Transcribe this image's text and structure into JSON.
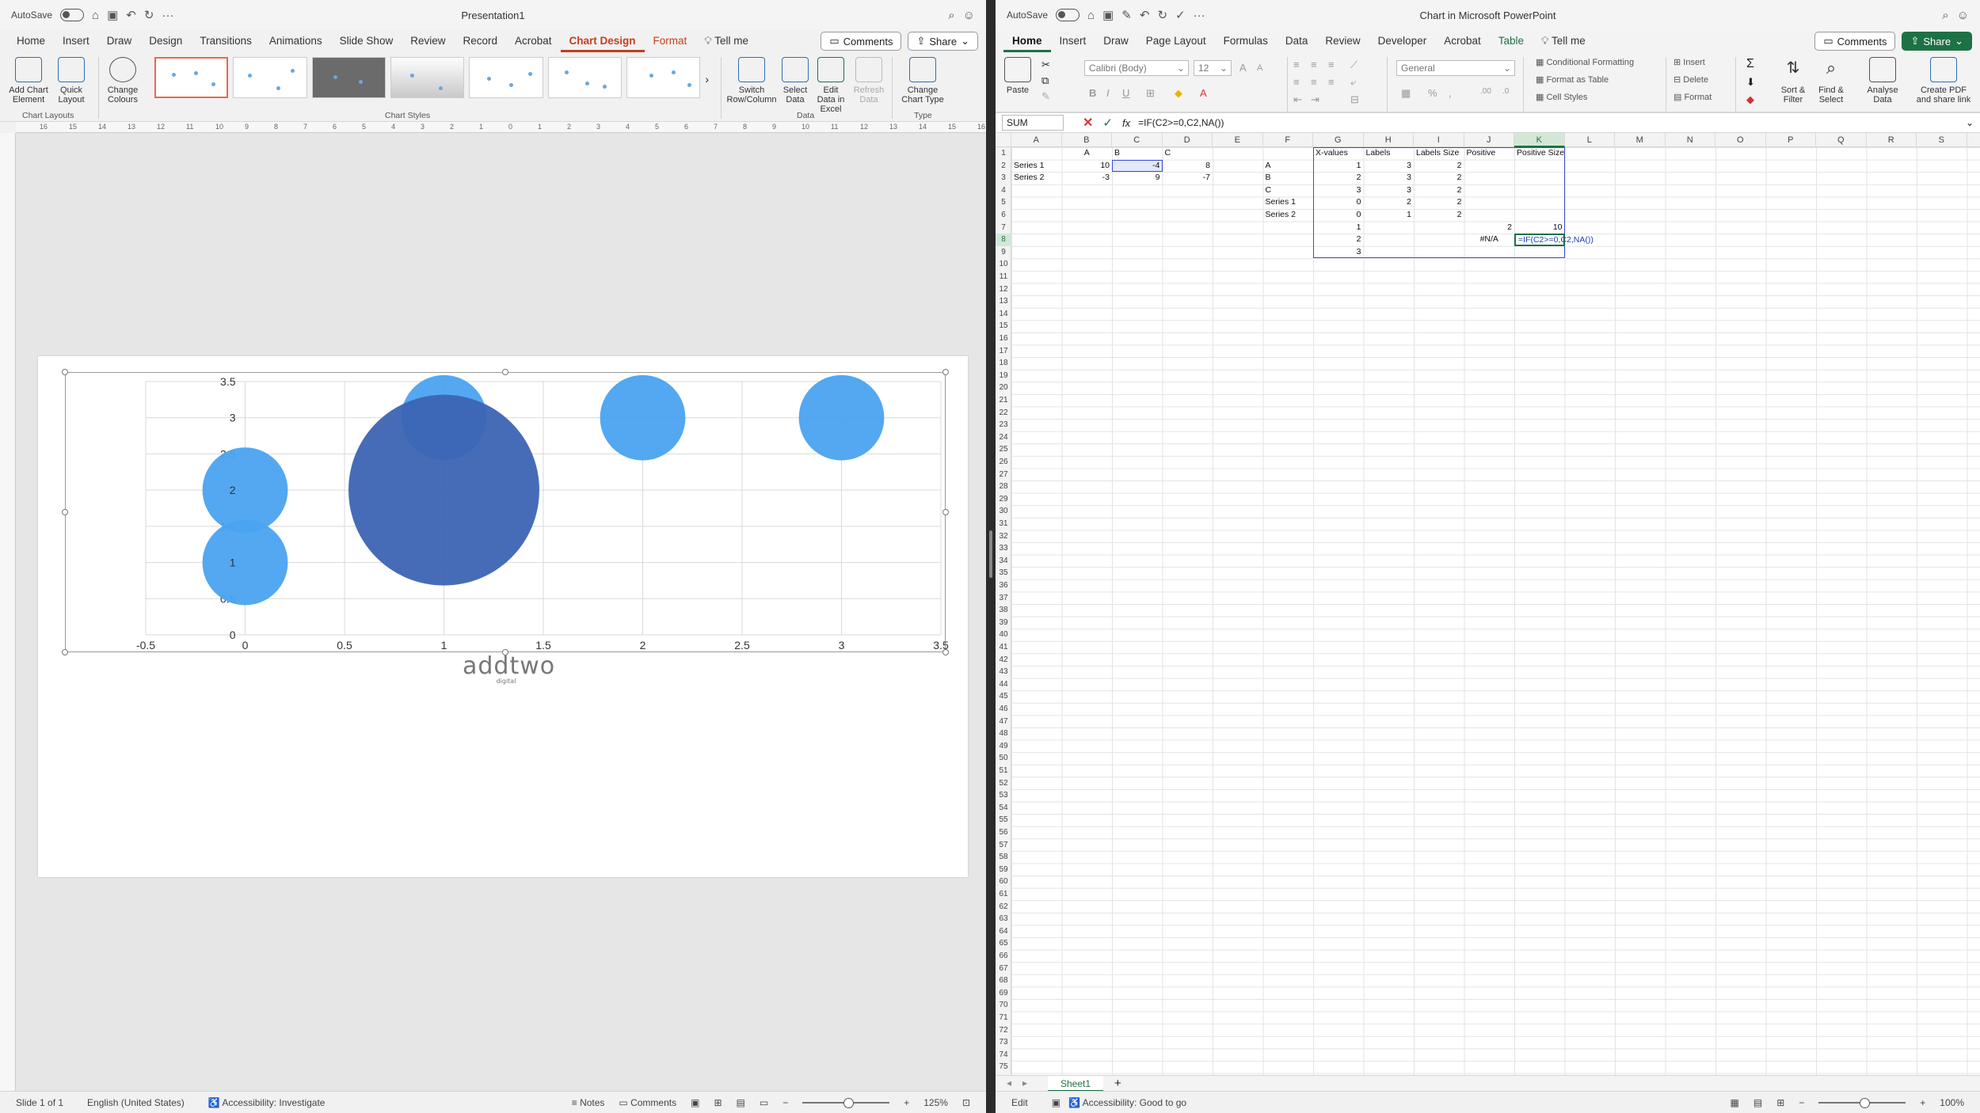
{
  "ppt": {
    "autosave_label": "AutoSave",
    "title": "Presentation1",
    "tabs": [
      "Home",
      "Insert",
      "Draw",
      "Design",
      "Transitions",
      "Animations",
      "Slide Show",
      "Review",
      "Record",
      "Acrobat",
      "Chart Design",
      "Format"
    ],
    "tell_me": "Tell me",
    "comments_label": "Comments",
    "share_label": "Share",
    "ribbon": {
      "add_chart_element": "Add Chart Element",
      "quick_layout": "Quick Layout",
      "change_colours": "Change Colours",
      "switch_row_column": "Switch Row/Column",
      "select_data": "Select Data",
      "edit_data_in_excel": "Edit Data in Excel",
      "refresh_data": "Refresh Data",
      "change_chart_type": "Change Chart Type",
      "group_chart_layouts": "Chart Layouts",
      "group_chart_styles": "Chart Styles",
      "group_data": "Data",
      "group_type": "Type"
    },
    "logo": "addtwo",
    "logo_sub": "digital",
    "status": {
      "slide": "Slide 1 of 1",
      "language": "English (United States)",
      "accessibility": "Accessibility: Investigate",
      "notes": "Notes",
      "comments": "Comments",
      "zoom": "125%"
    }
  },
  "chart_data": {
    "type": "scatter",
    "subtype": "bubble",
    "xlim": [
      -0.5,
      3.5
    ],
    "ylim": [
      0,
      3.5
    ],
    "x_ticks": [
      "-0.5",
      "0",
      "0.5",
      "1",
      "1.5",
      "2",
      "2.5",
      "3",
      "3.5"
    ],
    "y_ticks": [
      "0",
      "0.5",
      "1",
      "1.5",
      "2",
      "2.5",
      "3",
      "3.5"
    ],
    "grid": true,
    "series": [
      {
        "points": [
          {
            "x": 0,
            "y": 1,
            "size": 2,
            "label": "1"
          },
          {
            "x": 0,
            "y": 2,
            "size": 2,
            "label": "2"
          },
          {
            "x": 1,
            "y": 3,
            "size": 2
          },
          {
            "x": 2,
            "y": 3,
            "size": 2
          },
          {
            "x": 3,
            "y": 3,
            "size": 2
          }
        ],
        "color": "#4aa3f0"
      },
      {
        "points": [
          {
            "x": 1,
            "y": 2,
            "size": 10
          }
        ],
        "color": "#3c64b4"
      }
    ]
  },
  "xl": {
    "autosave_label": "AutoSave",
    "title": "Chart in Microsoft PowerPoint",
    "tabs": [
      "Home",
      "Insert",
      "Draw",
      "Page Layout",
      "Formulas",
      "Data",
      "Review",
      "Developer",
      "Acrobat",
      "Table"
    ],
    "tell_me": "Tell me",
    "comments_label": "Comments",
    "share_label": "Share",
    "ribbon": {
      "paste": "Paste",
      "font_name": "Calibri (Body)",
      "font_size": "12",
      "number_format": "General",
      "conditional_formatting": "Conditional Formatting",
      "format_as_table": "Format as Table",
      "cell_styles": "Cell Styles",
      "insert": "Insert",
      "delete": "Delete",
      "format": "Format",
      "sort_filter": "Sort & Filter",
      "find_select": "Find & Select",
      "analyse_data": "Analyse Data",
      "create_pdf": "Create PDF and share link"
    },
    "name_box": "SUM",
    "formula": "=IF(C2>=0,C2,NA())",
    "columns": [
      "A",
      "B",
      "C",
      "D",
      "E",
      "F",
      "G",
      "H",
      "I",
      "J",
      "K",
      "L",
      "M",
      "N",
      "O",
      "P",
      "Q",
      "R",
      "S"
    ],
    "cells": [
      {
        "col": 1,
        "row": 1,
        "v": "A",
        "align": "c"
      },
      {
        "col": 2,
        "row": 1,
        "v": "B"
      },
      {
        "col": 3,
        "row": 1,
        "v": "C"
      },
      {
        "col": 0,
        "row": 2,
        "v": "Series 1"
      },
      {
        "col": 1,
        "row": 2,
        "v": "10",
        "align": "r"
      },
      {
        "col": 2,
        "row": 2,
        "v": "-4",
        "align": "r"
      },
      {
        "col": 3,
        "row": 2,
        "v": "8",
        "align": "r"
      },
      {
        "col": 0,
        "row": 3,
        "v": "Series 2"
      },
      {
        "col": 1,
        "row": 3,
        "v": "-3",
        "align": "r"
      },
      {
        "col": 2,
        "row": 3,
        "v": "9",
        "align": "r"
      },
      {
        "col": 3,
        "row": 3,
        "v": "-7",
        "align": "r"
      },
      {
        "col": 6,
        "row": 1,
        "v": "X-values"
      },
      {
        "col": 7,
        "row": 1,
        "v": "Labels"
      },
      {
        "col": 8,
        "row": 1,
        "v": "Labels Size"
      },
      {
        "col": 9,
        "row": 1,
        "v": "Positive"
      },
      {
        "col": 10,
        "row": 1,
        "v": "Positive Size"
      },
      {
        "col": 5,
        "row": 2,
        "v": "A"
      },
      {
        "col": 5,
        "row": 3,
        "v": "B"
      },
      {
        "col": 5,
        "row": 4,
        "v": "C"
      },
      {
        "col": 5,
        "row": 5,
        "v": "Series 1"
      },
      {
        "col": 5,
        "row": 6,
        "v": "Series 2"
      },
      {
        "col": 6,
        "row": 2,
        "v": "1",
        "align": "r"
      },
      {
        "col": 6,
        "row": 3,
        "v": "2",
        "align": "r"
      },
      {
        "col": 6,
        "row": 4,
        "v": "3",
        "align": "r"
      },
      {
        "col": 6,
        "row": 5,
        "v": "0",
        "align": "r"
      },
      {
        "col": 6,
        "row": 6,
        "v": "0",
        "align": "r"
      },
      {
        "col": 6,
        "row": 7,
        "v": "1",
        "align": "r"
      },
      {
        "col": 6,
        "row": 8,
        "v": "2",
        "align": "r"
      },
      {
        "col": 6,
        "row": 9,
        "v": "3",
        "align": "r"
      },
      {
        "col": 7,
        "row": 2,
        "v": "3",
        "align": "r"
      },
      {
        "col": 7,
        "row": 3,
        "v": "3",
        "align": "r"
      },
      {
        "col": 7,
        "row": 4,
        "v": "3",
        "align": "r"
      },
      {
        "col": 7,
        "row": 5,
        "v": "2",
        "align": "r"
      },
      {
        "col": 7,
        "row": 6,
        "v": "1",
        "align": "r"
      },
      {
        "col": 8,
        "row": 2,
        "v": "2",
        "align": "r"
      },
      {
        "col": 8,
        "row": 3,
        "v": "2",
        "align": "r"
      },
      {
        "col": 8,
        "row": 4,
        "v": "2",
        "align": "r"
      },
      {
        "col": 8,
        "row": 5,
        "v": "2",
        "align": "r"
      },
      {
        "col": 8,
        "row": 6,
        "v": "2",
        "align": "r"
      },
      {
        "col": 9,
        "row": 7,
        "v": "2",
        "align": "r"
      },
      {
        "col": 10,
        "row": 7,
        "v": "10",
        "align": "r"
      },
      {
        "col": 9,
        "row": 8,
        "v": "#N/A",
        "align": "c"
      }
    ],
    "active_cell_text": "=IF(C2>=0,C2,NA())",
    "sheet_tab": "Sheet1",
    "status": {
      "mode": "Edit",
      "accessibility": "Accessibility: Good to go",
      "zoom": "100%"
    }
  }
}
